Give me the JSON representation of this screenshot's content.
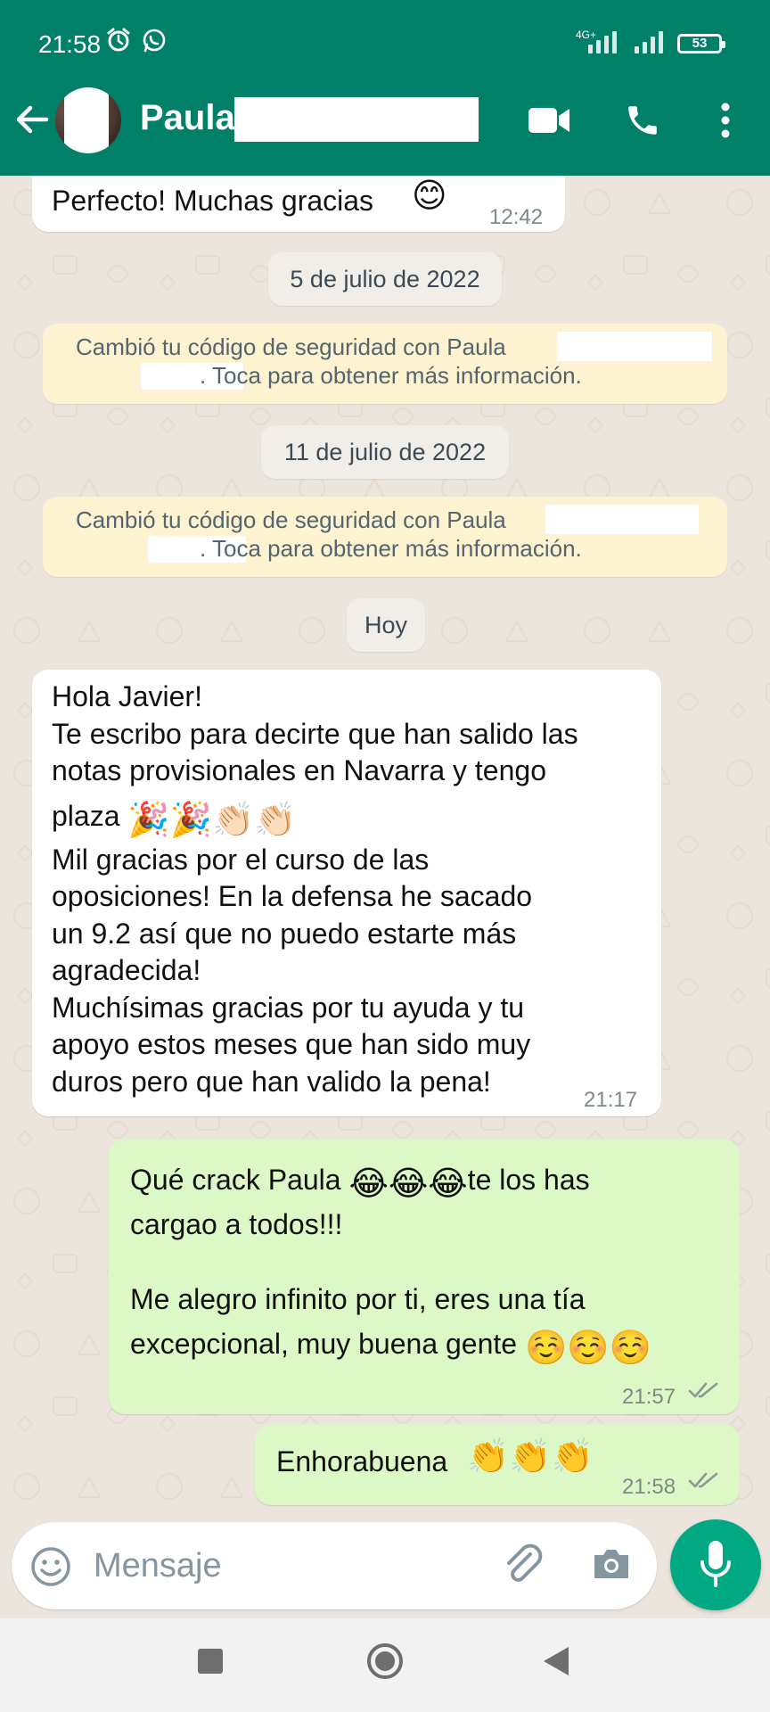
{
  "status_bar": {
    "time": "21:58",
    "network": "4G+",
    "battery": "53"
  },
  "header": {
    "contact_name": "Paula",
    "icons": [
      "back-arrow-icon",
      "video-call-icon",
      "phone-icon",
      "more-vert-icon"
    ]
  },
  "chat": {
    "messages": [
      {
        "direction": "in",
        "text": "Perfecto! Muchas gracias",
        "emoji": "😊",
        "time": "12:42"
      },
      {
        "type": "date",
        "label": "5 de julio de 2022"
      },
      {
        "type": "system",
        "line1": "Cambió tu código de seguridad con Paula",
        "line2": ". Toca para obtener más información."
      },
      {
        "type": "date",
        "label": "11 de julio de 2022"
      },
      {
        "type": "system",
        "line1": "Cambió tu código de seguridad con Paula",
        "line2": ". Toca para obtener más información."
      },
      {
        "type": "date",
        "label": "Hoy"
      },
      {
        "direction": "in",
        "lines": [
          "Hola Javier!",
          "Te escribo para decirte que han salido las",
          "notas provisionales en Navarra y tengo",
          "plaza",
          "Mil gracias por el curso de las",
          "oposiciones! En la defensa he sacado",
          "un 9.2 así que no puedo estarte más",
          "agradecida!",
          "Muchísimas gracias por tu ayuda y tu",
          "apoyo estos meses que han sido muy",
          "duros pero que han valido la pena!"
        ],
        "plaza_emojis": "🎉🎉👏🏻👏🏻",
        "time": "21:17"
      },
      {
        "direction": "out",
        "p1_a": "Qué crack Paula",
        "p1_emojis": "😂😂😂",
        "p1_b": "te los has",
        "p1_c": "cargao a todos!!!",
        "p2_a": "Me alegro infinito por ti, eres una tía",
        "p2_b": "excepcional, muy buena gente",
        "p2_emojis": "☺️☺️☺️",
        "time": "21:57",
        "status": "delivered"
      },
      {
        "direction": "out",
        "text": "Enhorabuena",
        "emojis": "👏👏👏",
        "time": "21:58",
        "status": "delivered"
      }
    ]
  },
  "input": {
    "placeholder": "Mensaje",
    "icons": [
      "emoji-icon",
      "attach-icon",
      "camera-icon",
      "mic-icon"
    ]
  },
  "navigation": {
    "buttons": [
      "recents-button",
      "home-button",
      "back-button"
    ]
  },
  "colors": {
    "header": "#008069",
    "chat_background": "#ECE5DD",
    "outgoing_bubble": "#DCF8C6",
    "incoming_bubble": "#FFFFFF",
    "system_notice": "#FDF3D0",
    "accent": "#00A884"
  }
}
